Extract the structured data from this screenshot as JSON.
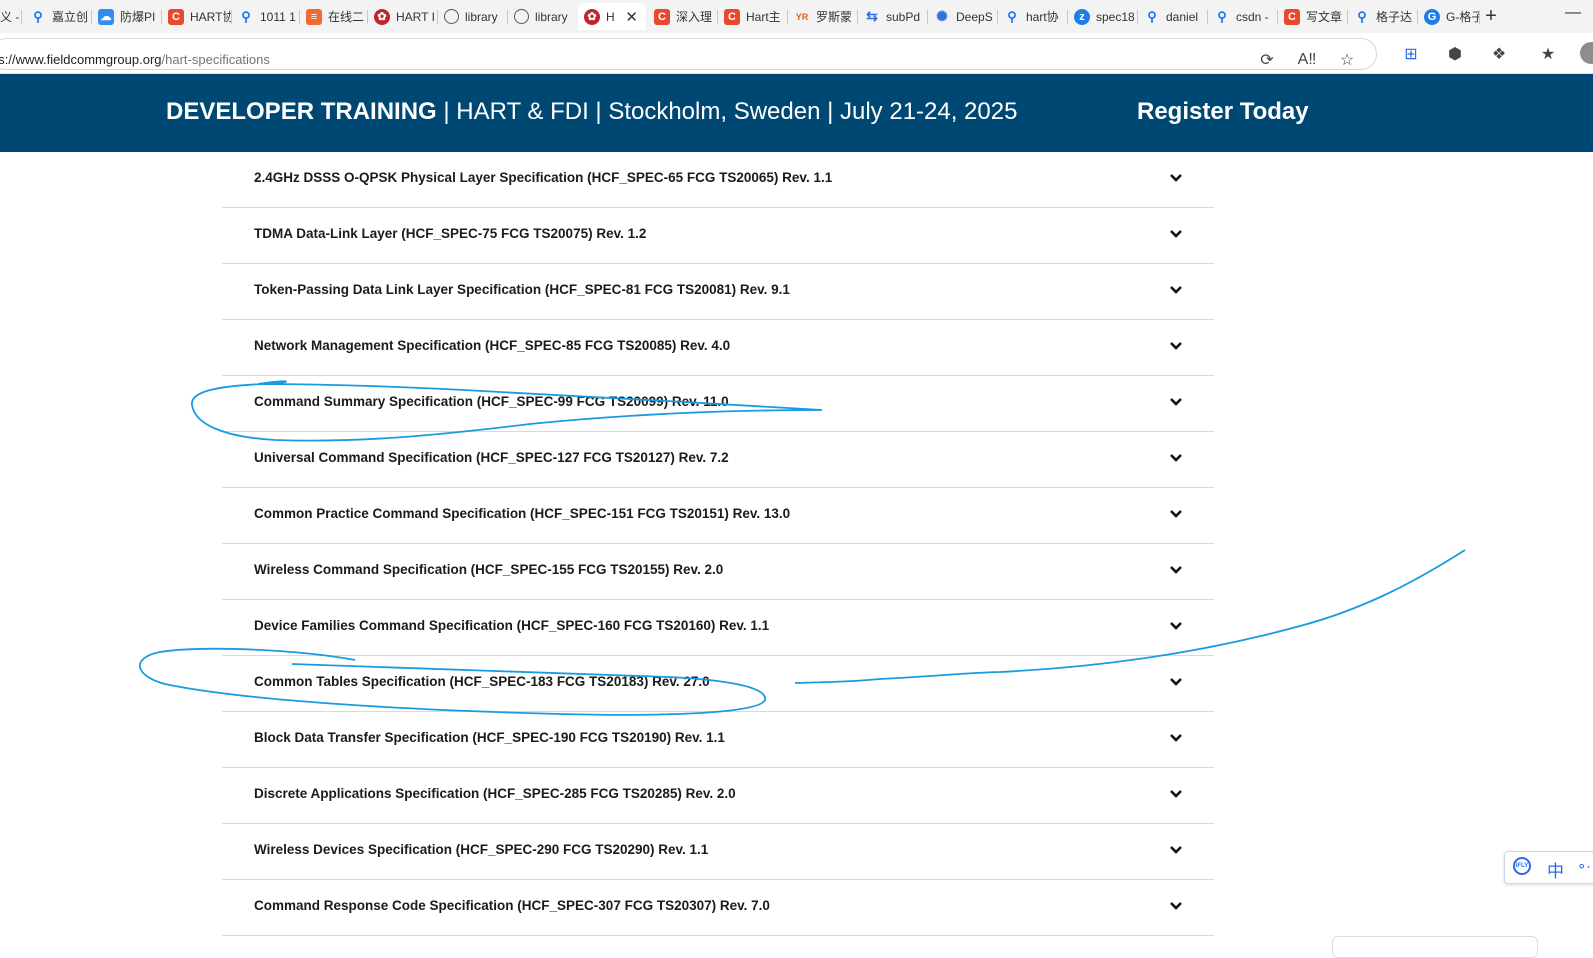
{
  "browser": {
    "tabs": [
      {
        "title": "义 -",
        "icon": "text-icon"
      },
      {
        "title": "嘉立创",
        "icon": "search-icon"
      },
      {
        "title": "防爆PI",
        "icon": "chat-icon"
      },
      {
        "title": "HART协",
        "icon": "csdn-icon"
      },
      {
        "title": "1011 1",
        "icon": "search-icon"
      },
      {
        "title": "在线二",
        "icon": "tool-icon"
      },
      {
        "title": "HART I",
        "icon": "fieldcomm-icon"
      },
      {
        "title": "library",
        "icon": "globe-icon"
      },
      {
        "title": "library",
        "icon": "globe-icon"
      },
      {
        "title": "H",
        "icon": "fieldcomm-icon",
        "active": true
      },
      {
        "title": "深入理",
        "icon": "csdn-icon"
      },
      {
        "title": "Hart主",
        "icon": "csdn-icon"
      },
      {
        "title": "罗斯蒙",
        "icon": "yr-icon"
      },
      {
        "title": "subPd",
        "icon": "sync-icon"
      },
      {
        "title": "DeepS",
        "icon": "deepseek-icon"
      },
      {
        "title": "hart协",
        "icon": "search-icon"
      },
      {
        "title": "spec18",
        "icon": "zhihu-icon"
      },
      {
        "title": "daniel",
        "icon": "search-icon"
      },
      {
        "title": "csdn -",
        "icon": "search-icon"
      },
      {
        "title": "写文章",
        "icon": "csdn-icon"
      },
      {
        "title": "格子达",
        "icon": "search-icon"
      },
      {
        "title": "G-格子",
        "icon": "g-icon"
      }
    ],
    "close_glyph": "✕",
    "new_tab_glyph": "+",
    "minimize_glyph": "—",
    "url_host": "os://www.fieldcommgroup.org",
    "url_path": "/hart-specifications"
  },
  "banner": {
    "strong": "DEVELOPER TRAINING",
    "rest": " | HART & FDI | Stockholm, Sweden | July 21-24, 2025",
    "register": "Register Today"
  },
  "specs": [
    "2.4GHz DSSS O-QPSK Physical Layer Specification (HCF_SPEC-65 FCG TS20065) Rev. 1.1",
    "TDMA Data-Link Layer (HCF_SPEC-75 FCG TS20075) Rev. 1.2",
    "Token-Passing Data Link Layer Specification (HCF_SPEC-81 FCG TS20081) Rev. 9.1",
    "Network Management Specification (HCF_SPEC-85 FCG TS20085) Rev. 4.0",
    "Command Summary Specification (HCF_SPEC-99 FCG TS20099) Rev. 11.0",
    "Universal Command Specification (HCF_SPEC-127 FCG TS20127) Rev. 7.2",
    "Common Practice Command Specification (HCF_SPEC-151 FCG TS20151) Rev. 13.0",
    "Wireless Command Specification (HCF_SPEC-155 FCG TS20155) Rev. 2.0",
    "Device Families Command Specification (HCF_SPEC-160 FCG TS20160) Rev. 1.1",
    "Common Tables Specification (HCF_SPEC-183 FCG TS20183) Rev. 27.0",
    "Block Data Transfer Specification (HCF_SPEC-190 FCG TS20190) Rev. 1.1",
    "Discrete Applications Specification (HCF_SPEC-285 FCG TS20285) Rev. 2.0",
    "Wireless Devices Specification (HCF_SPEC-290 FCG TS20290) Rev. 1.1",
    "Command Response Code Specification (HCF_SPEC-307 FCG TS20307) Rev. 7.0"
  ],
  "ime": {
    "lang": "中",
    "logo": "iFLY"
  },
  "colors": {
    "banner_bg": "#004874",
    "ink": "#1a9be0",
    "divider": "#d9d9d9"
  }
}
